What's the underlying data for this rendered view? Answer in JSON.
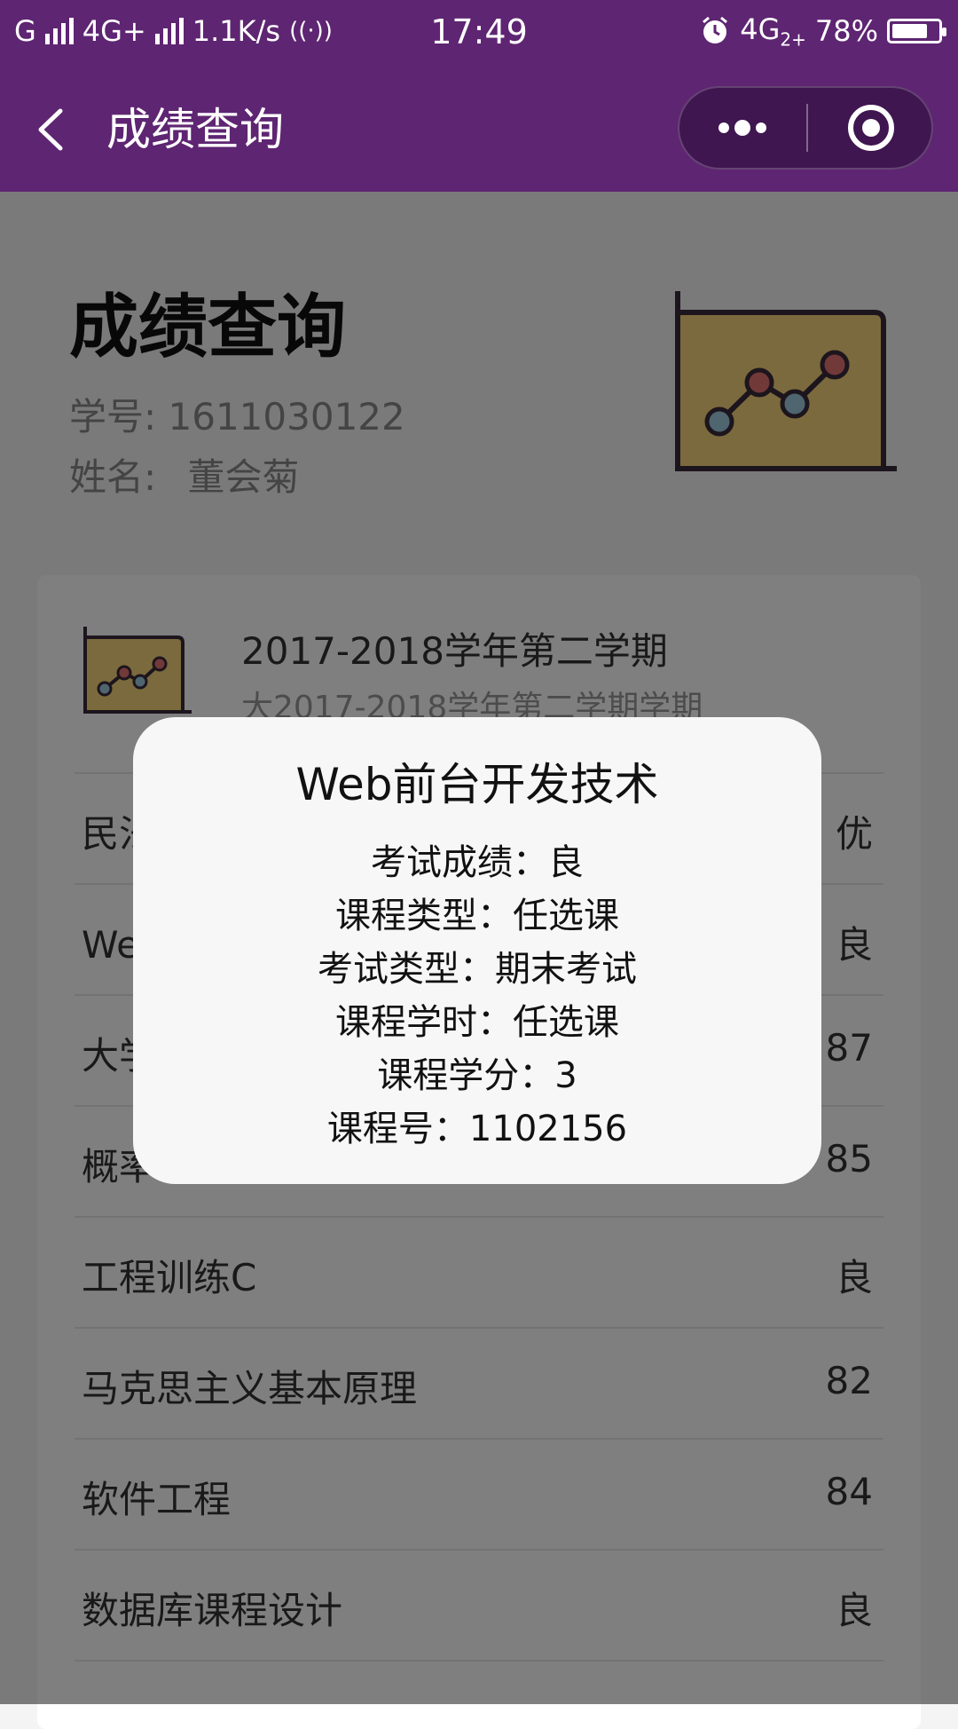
{
  "status_bar": {
    "carrier_1": "G",
    "network_1": "4G+",
    "speed": "1.1K/s",
    "time": "17:49",
    "network_2": "4G",
    "sub_network": "2+",
    "battery": "78%",
    "battery_level": 0.78
  },
  "nav": {
    "title": "成绩查询"
  },
  "page": {
    "title": "成绩查询",
    "student_id_label": "学号:",
    "student_id": "1611030122",
    "name_label": "姓名:",
    "name": "董会菊"
  },
  "term": {
    "title": "2017-2018学年第二学期",
    "subtitle": "大2017-2018学年第二学期学期"
  },
  "courses": [
    {
      "name": "民法",
      "score": "优"
    },
    {
      "name": "Web前台开发技术",
      "score": "良"
    },
    {
      "name": "大学",
      "score": "87"
    },
    {
      "name": "概率",
      "score": "85"
    },
    {
      "name": "工程训练C",
      "score": "良"
    },
    {
      "name": "马克思主义基本原理",
      "score": "82"
    },
    {
      "name": "软件工程",
      "score": "84"
    },
    {
      "name": "数据库课程设计",
      "score": "良"
    }
  ],
  "modal": {
    "title": "Web前台开发技术",
    "lines": [
      "考试成绩：良",
      "课程类型：任选课",
      "考试类型：期末考试",
      "课程学时：任选课",
      "课程学分：3",
      "课程号：1102156"
    ]
  },
  "colors": {
    "nav_bg": "#5e2572",
    "chart_fill": "#f7d57a",
    "chart_line": "#3a2a3a",
    "dot_red": "#e57373",
    "dot_blue": "#9ecbe0"
  },
  "icons": [
    "back-icon",
    "more-icon",
    "close-target-icon",
    "chart-illustration",
    "battery-icon",
    "alarm-icon"
  ]
}
